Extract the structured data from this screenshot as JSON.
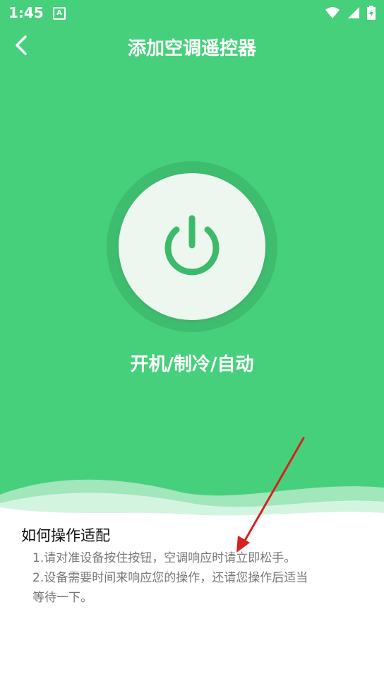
{
  "status_bar": {
    "time": "1:45",
    "notification_letter": "A"
  },
  "header": {
    "title": "添加空调遥控器"
  },
  "power": {
    "label": "开机/制冷/自动"
  },
  "guide": {
    "title": "如何操作适配",
    "lines": [
      "1.请对准设备按住按钮，空调响应时请立即松手。",
      "2.设备需要时间来响应您的操作，还请您操作后适当",
      "等待一下。"
    ]
  },
  "colors": {
    "primary": "#47d07c",
    "power_ring": "#3fbd6f",
    "power_face": "#eef6f0",
    "icon": "#3bbb69"
  },
  "icons": [
    "back-arrow-icon",
    "power-icon",
    "wifi-icon",
    "signal-icon",
    "battery-icon"
  ]
}
